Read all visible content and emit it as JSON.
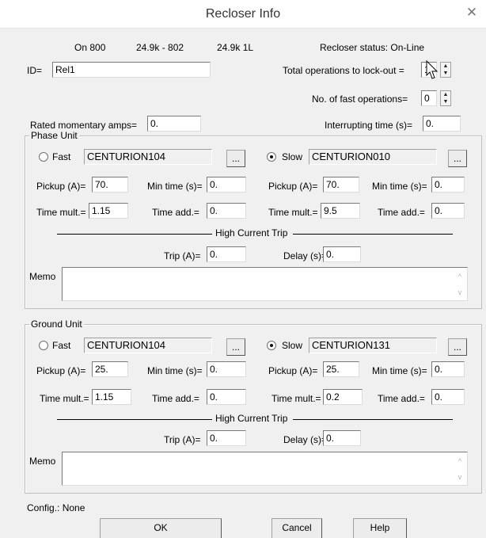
{
  "window": {
    "title": "Recloser Info",
    "close_glyph": "✕"
  },
  "header": {
    "on_device": "On 800",
    "location_range": "24.9k - 802",
    "location_code": "24.9k 1L",
    "status": "Recloser status: On-Line"
  },
  "fields": {
    "id_label": "ID=",
    "id_value": "Rel1",
    "total_ops_label": "Total operations to lock-out =",
    "total_ops_value": "1",
    "fast_ops_label": "No. of fast operations=",
    "fast_ops_value": "0",
    "rated_amps_label": "Rated momentary amps=",
    "rated_amps_value": "0.",
    "interrupting_label": "Interrupting time (s)=",
    "interrupting_value": "0."
  },
  "phase_unit": {
    "title": "Phase Unit",
    "fast_label": "Fast",
    "fast_curve": "CENTURION104",
    "slow_label": "Slow",
    "slow_curve": "CENTURION010",
    "browse_label": "...",
    "selected": "slow",
    "pickup_label": "Pickup (A)=",
    "min_time_label": "Min time (s)=",
    "time_mult_label": "Time mult.=",
    "time_add_label": "Time add.=",
    "fast_pickup": "70.",
    "fast_min_time": "0.",
    "fast_time_mult": "1.15",
    "fast_time_add": "0.",
    "slow_pickup": "70.",
    "slow_min_time": "0.",
    "slow_time_mult": "9.5",
    "slow_time_add": "0.",
    "high_current_trip_label": "High Current Trip",
    "trip_label": "Trip (A)=",
    "trip_value": "0.",
    "delay_label": "Delay (s)=",
    "delay_value": "0.",
    "memo_label": "Memo",
    "memo_value": ""
  },
  "ground_unit": {
    "title": "Ground Unit",
    "fast_label": "Fast",
    "fast_curve": "CENTURION104",
    "slow_label": "Slow",
    "slow_curve": "CENTURION131",
    "browse_label": "...",
    "selected": "slow",
    "pickup_label": "Pickup (A)=",
    "min_time_label": "Min time (s)=",
    "time_mult_label": "Time mult.=",
    "time_add_label": "Time add.=",
    "fast_pickup": "25.",
    "fast_min_time": "0.",
    "fast_time_mult": "1.15",
    "fast_time_add": "0.",
    "slow_pickup": "25.",
    "slow_min_time": "0.",
    "slow_time_mult": "0.2",
    "slow_time_add": "0.",
    "high_current_trip_label": "High Current Trip",
    "trip_label": "Trip (A)=",
    "trip_value": "0.",
    "delay_label": "Delay (s)=",
    "delay_value": "0.",
    "memo_label": "Memo",
    "memo_value": ""
  },
  "footer": {
    "config_text": "Config.: None",
    "ok_label": "OK",
    "cancel_label": "Cancel",
    "help_label": "Help"
  },
  "icons": {
    "spin_up": "▲",
    "spin_down": "▼",
    "scroll_up": "^",
    "scroll_down": "v"
  }
}
